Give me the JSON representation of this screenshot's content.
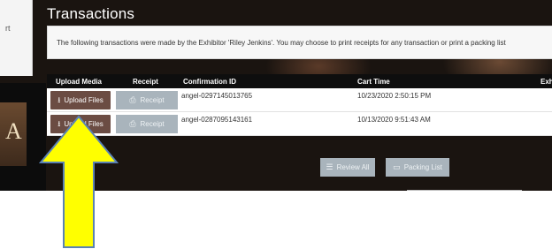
{
  "page": {
    "title": "Transactions",
    "info_text": "The following transactions were made by the Exhibitor 'Riley Jenkins'. You may choose to print receipts for any transaction or print a packing list"
  },
  "left_panel": {
    "fragment": "rt",
    "poster_letter": "A"
  },
  "table": {
    "headers": {
      "upload_media": "Upload Media",
      "receipt": "Receipt",
      "confirmation_id": "Confirmation ID",
      "cart_time": "Cart Time",
      "exhibitor": "Exh"
    },
    "rows": [
      {
        "upload_label": "Upload Files",
        "receipt_label": "Receipt",
        "confirmation_id": "angel-0297145013765",
        "cart_time": "10/23/2020 2:50:15 PM"
      },
      {
        "upload_label": "Upload Files",
        "receipt_label": "Receipt",
        "confirmation_id": "angel-0287095143161",
        "cart_time": "10/13/2020 9:51:43 AM"
      }
    ]
  },
  "actions": {
    "review_all": "Review All",
    "packing_list": "Packing List"
  },
  "icons": {
    "upload": "upload-icon",
    "print": "print-icon",
    "list": "list-icon",
    "packing": "packing-list-icon"
  },
  "colors": {
    "upload_button": "#6b4c43",
    "receipt_button": "#a9b4bc",
    "table_header": "#0e0e0e",
    "arrow_fill": "#ffff00",
    "arrow_stroke": "#5a82b4"
  }
}
